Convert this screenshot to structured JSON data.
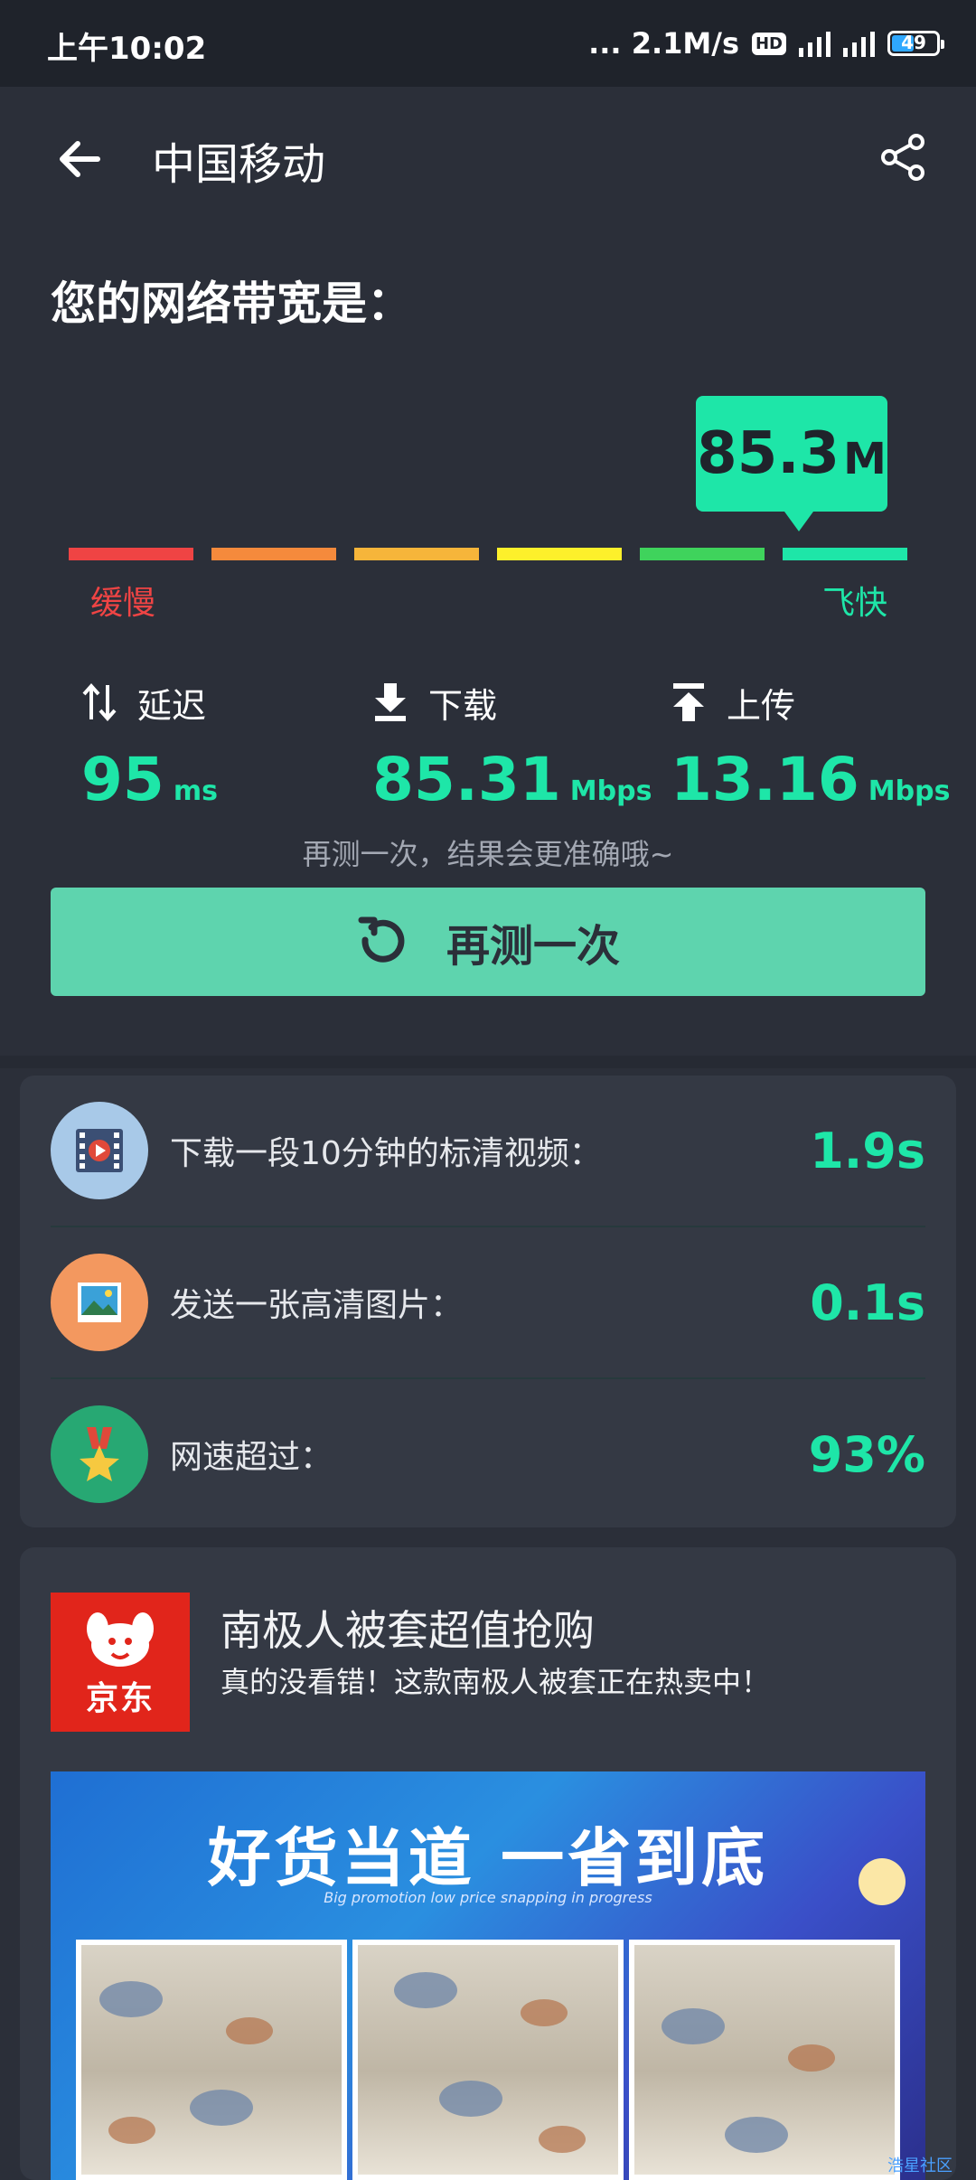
{
  "status_bar": {
    "time": "上午10:02",
    "network_speed": "... 2.1M/s",
    "hd_label": "HD",
    "battery": "49"
  },
  "app_bar": {
    "title": "中国移动"
  },
  "speed_test": {
    "heading": "您的网络带宽是：",
    "bubble_value": "85.3",
    "bubble_unit": "M",
    "gauge_slow": "缓慢",
    "gauge_fast": "飞快",
    "gauge_colors": [
      "#ef4444",
      "#f58a3c",
      "#f6b53a",
      "#fdf02b",
      "#3fd35c",
      "#1ee6a8"
    ],
    "metrics": [
      {
        "icon": "swap-vertical-icon",
        "label": "延迟",
        "value": "95",
        "unit": "ms"
      },
      {
        "icon": "download-icon",
        "label": "下载",
        "value": "85.31",
        "unit": "Mbps"
      },
      {
        "icon": "upload-icon",
        "label": "上传",
        "value": "13.16",
        "unit": "Mbps"
      }
    ],
    "retest_hint": "再测一次，结果会更准确哦~",
    "retest_label": "再测一次"
  },
  "stats": [
    {
      "icon": "video-icon",
      "text": "下载一段10分钟的标清视频：",
      "value": "1.9s"
    },
    {
      "icon": "picture-icon",
      "text": "发送一张高清图片：",
      "value": "0.1s"
    },
    {
      "icon": "medal-icon",
      "text": "网速超过：",
      "value": "93%"
    }
  ],
  "ad": {
    "brand": "京东",
    "title": "南极人被套超值抢购",
    "subtitle": "真的没看错！这款南极人被套正在热卖中！",
    "banner_headline": "好货当道 一省到底",
    "banner_sub": "Big promotion low price snapping in progress"
  },
  "watermark": "浩星社区",
  "colors": {
    "accent": "#1ee6a8",
    "button": "#5ed4ae",
    "background": "#2b2f39",
    "card": "#343944"
  }
}
